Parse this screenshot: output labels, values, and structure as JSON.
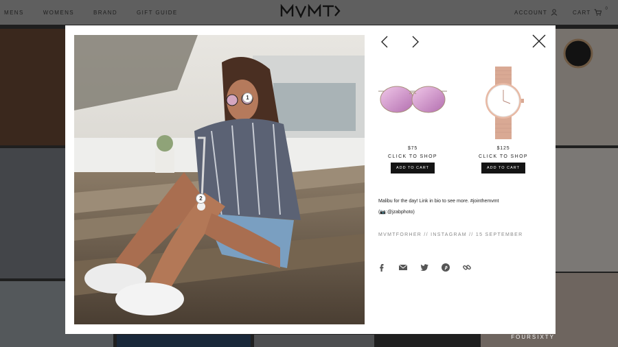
{
  "nav": {
    "left": [
      "MENS",
      "WOMENS",
      "BRAND",
      "GIFT GUIDE"
    ],
    "logo": "MVMT",
    "account_label": "ACCOUNT",
    "cart_label": "CART",
    "cart_count": "0"
  },
  "modal": {
    "hotspots": [
      "1",
      "2"
    ],
    "products": [
      {
        "name": "sunglasses",
        "price": "$75",
        "shop_label": "CLICK TO SHOP",
        "button_label": "ADD TO CART"
      },
      {
        "name": "watch",
        "price": "$125",
        "shop_label": "CLICK TO SHOP",
        "button_label": "ADD TO CART"
      }
    ],
    "caption_line1": "Malibu for the day! Link in bio to see more. #jointhemvmt",
    "caption_line2": "(📷:@jzabphoto)",
    "meta": "MVMTFORHER // INSTAGRAM // 15 SEPTEMBER",
    "share_icons": [
      "facebook-icon",
      "email-icon",
      "twitter-icon",
      "pinterest-icon",
      "link-icon"
    ]
  },
  "footer": {
    "brandmark": "FOURSIXTY"
  },
  "colors": {
    "modal_bg": "#ffffff",
    "button_bg": "#141414",
    "meta_text": "#8a8a8a",
    "nav_bg": "#5f5f5f"
  }
}
